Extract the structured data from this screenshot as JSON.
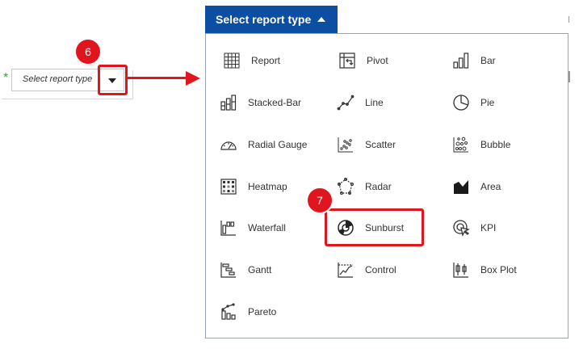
{
  "left_select": {
    "required_mark": "*",
    "placeholder": "Select report type"
  },
  "dropdown_button": {
    "label": "Select report type"
  },
  "badges": {
    "step6": "6",
    "step7": "7"
  },
  "menu": {
    "items": [
      {
        "label": "Report",
        "icon": "grid-icon"
      },
      {
        "label": "Pivot",
        "icon": "pivot-icon"
      },
      {
        "label": "Bar",
        "icon": "bar-chart-icon"
      },
      {
        "label": "Stacked-Bar",
        "icon": "stacked-bar-icon"
      },
      {
        "label": "Line",
        "icon": "line-chart-icon"
      },
      {
        "label": "Pie",
        "icon": "pie-chart-icon"
      },
      {
        "label": "Radial Gauge",
        "icon": "gauge-icon"
      },
      {
        "label": "Scatter",
        "icon": "scatter-icon"
      },
      {
        "label": "Bubble",
        "icon": "bubble-icon"
      },
      {
        "label": "Heatmap",
        "icon": "heatmap-icon"
      },
      {
        "label": "Radar",
        "icon": "radar-icon"
      },
      {
        "label": "Area",
        "icon": "area-chart-icon"
      },
      {
        "label": "Waterfall",
        "icon": "waterfall-icon"
      },
      {
        "label": "Sunburst",
        "icon": "sunburst-icon"
      },
      {
        "label": "KPI",
        "icon": "kpi-icon"
      },
      {
        "label": "Gantt",
        "icon": "gantt-icon"
      },
      {
        "label": "Control",
        "icon": "control-chart-icon"
      },
      {
        "label": "Box Plot",
        "icon": "box-plot-icon"
      },
      {
        "label": "Pareto",
        "icon": "pareto-icon"
      }
    ]
  },
  "colors": {
    "primary": "#0b4ea2",
    "annotation": "#e0151d",
    "required": "#3a9a3a"
  }
}
